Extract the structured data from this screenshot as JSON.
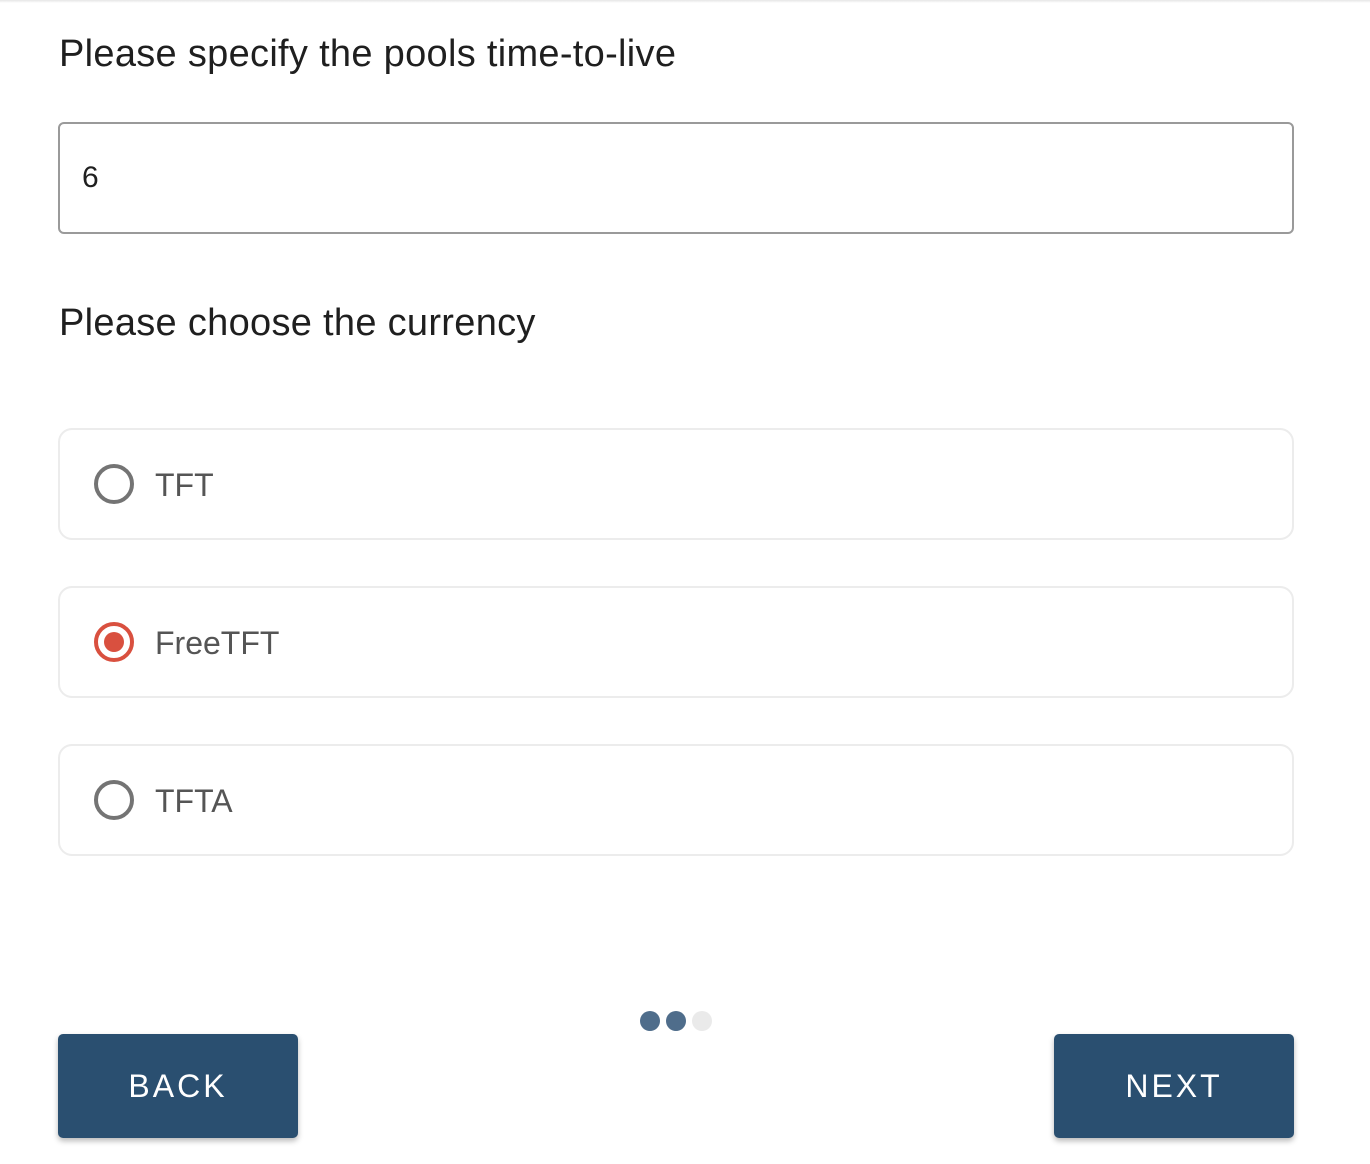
{
  "form": {
    "ttl_heading": "Please specify the pools time-to-live",
    "ttl_value": "6",
    "currency_heading": "Please choose the currency",
    "currency_options": [
      {
        "label": "TFT",
        "checked": false
      },
      {
        "label": "FreeTFT",
        "checked": true
      },
      {
        "label": "TFTA",
        "checked": false
      }
    ],
    "selected_currency": "FreeTFT"
  },
  "stepper": {
    "total_steps": 3,
    "active_steps": 2
  },
  "nav": {
    "back_label": "BACK",
    "next_label": "NEXT"
  },
  "colors": {
    "primary": "#2a4f70",
    "radio_selected": "#d9503f",
    "step_active": "#4f6d8b",
    "step_inactive": "#eaeaea"
  }
}
